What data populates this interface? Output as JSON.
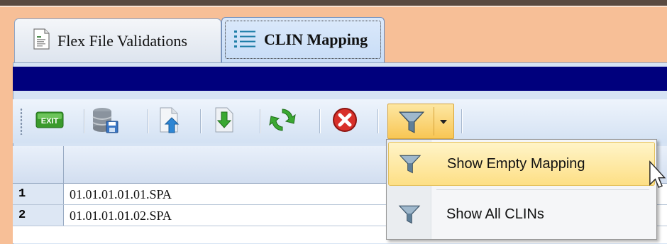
{
  "tabs": [
    {
      "label": "Flex File Validations",
      "icon": "document-icon",
      "active": false
    },
    {
      "label": "CLIN Mapping",
      "icon": "list-icon",
      "active": true
    }
  ],
  "toolbar": {
    "buttons": [
      {
        "name": "exit",
        "label": "EXIT",
        "icon": "exit-icon"
      },
      {
        "name": "save-database",
        "icon": "database-save-icon"
      },
      {
        "name": "upload",
        "icon": "upload-document-icon"
      },
      {
        "name": "download",
        "icon": "download-icon"
      },
      {
        "name": "refresh",
        "icon": "refresh-icon"
      },
      {
        "name": "delete",
        "icon": "delete-icon"
      },
      {
        "name": "filter",
        "icon": "filter-icon"
      }
    ]
  },
  "grid": {
    "rows": [
      {
        "num": "1",
        "value": "01.01.01.01.01.SPA"
      },
      {
        "num": "2",
        "value": "01.01.01.01.02.SPA"
      }
    ]
  },
  "filter_menu": {
    "items": [
      {
        "label": "Show Empty Mapping",
        "highlighted": true
      },
      {
        "label": "Show All CLINs",
        "highlighted": false
      }
    ]
  },
  "colors": {
    "accent": "#00007d",
    "window_bg": "#f7bf97",
    "highlight": "#fddf85"
  }
}
